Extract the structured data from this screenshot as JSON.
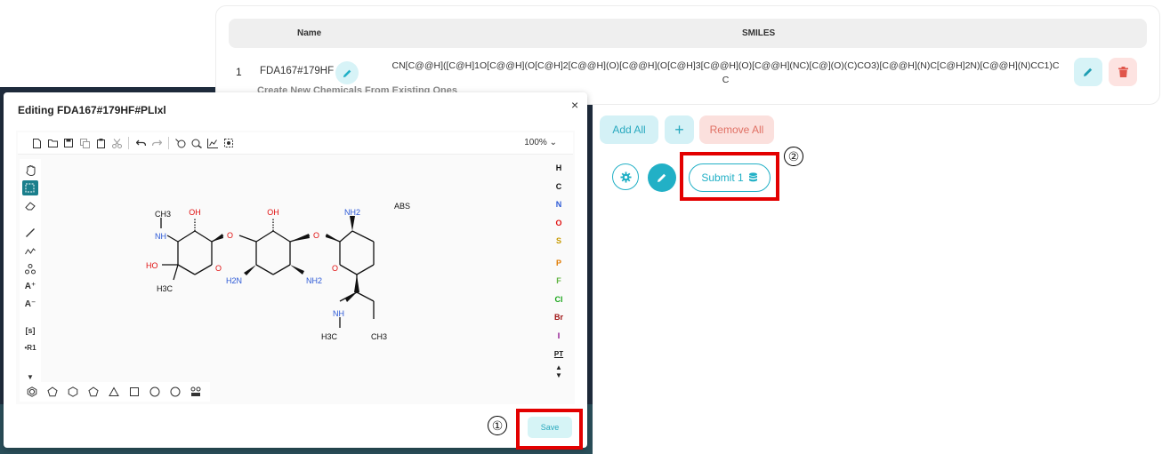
{
  "table": {
    "col_name": "Name",
    "col_smiles": "SMILES",
    "rows": [
      {
        "index": "1",
        "name": "FDA167#179HF",
        "smiles": "CN[C@@H]([C@H]1O[C@@H](O[C@H]2[C@@H](O)[C@@H](O[C@H]3[C@@H](O)[C@@H](NC)[C@](O)(C)CO3)[C@@H](N)C[C@H]2N)[C@@H](N)CC1)CC"
      }
    ]
  },
  "actions": {
    "add_all": "Add All",
    "plus": "+",
    "remove_all": "Remove All",
    "submit": "Submit 1"
  },
  "behind_text": "Create New Chemicals From Existing Ones",
  "modal": {
    "title": "Editing FDA167#179HF#PLIxl",
    "close": "×",
    "zoom": "100%",
    "save": "Save"
  },
  "elements": [
    "H",
    "C",
    "N",
    "O",
    "S",
    "P",
    "F",
    "Cl",
    "Br",
    "I",
    "PT"
  ],
  "element_colors": {
    "H": "#111111",
    "C": "#111111",
    "N": "#2b58d6",
    "O": "#e01010",
    "S": "#c79a00",
    "P": "#e07a00",
    "F": "#5db33d",
    "Cl": "#1aa61a",
    "Br": "#a01515",
    "I": "#8a0a8a",
    "PT": "#111111"
  },
  "molecule_labels": {
    "abs": "ABS",
    "ch3_top": "CH3",
    "nh_left": "NH",
    "oh_1": "OH",
    "ho_left": "HO",
    "h3c_left": "H3C",
    "o_ring1": "O",
    "o_link1": "O",
    "oh_2": "OH",
    "h2n": "H2N",
    "nh2_mid": "NH2",
    "o_link2": "O",
    "nh2_top": "NH2",
    "o_ring3": "O",
    "nh_bottom": "NH",
    "h3c_bottom": "H3C",
    "ch3_bottom": "CH3"
  },
  "annotations": {
    "one": "①",
    "two": "②"
  },
  "accent": "#22b0c6",
  "danger": "#e07064",
  "annotation_red": "#e30000"
}
